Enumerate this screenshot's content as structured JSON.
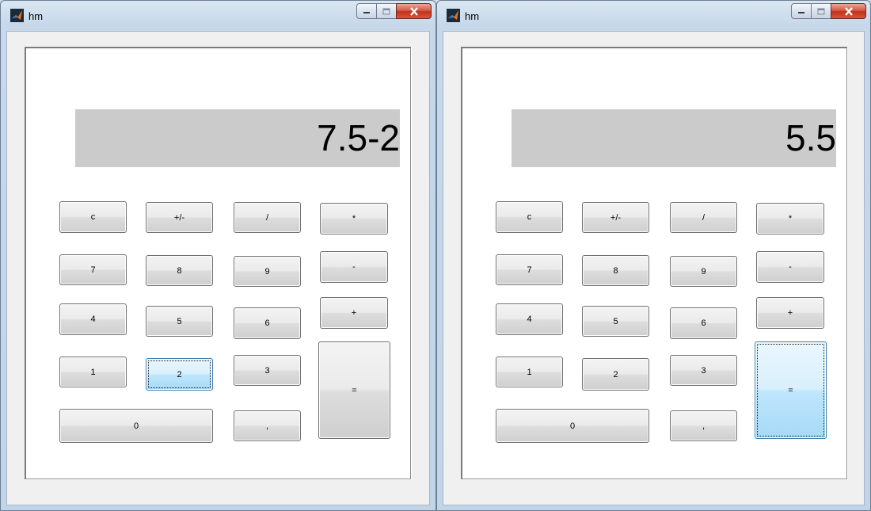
{
  "windows": [
    {
      "title": "hm",
      "display": "7.5-2",
      "buttons": {
        "c": "c",
        "plusminus": "+/-",
        "divide": "/",
        "multiply": "*",
        "seven": "7",
        "eight": "8",
        "nine": "9",
        "minus": "-",
        "four": "4",
        "five": "5",
        "six": "6",
        "plus": "+",
        "one": "1",
        "two": "2",
        "three": "3",
        "equals": "=",
        "zero": "0",
        "decimal": ","
      },
      "focused_button": "two"
    },
    {
      "title": "hm",
      "display": "5.5",
      "buttons": {
        "c": "c",
        "plusminus": "+/-",
        "divide": "/",
        "multiply": "*",
        "seven": "7",
        "eight": "8",
        "nine": "9",
        "minus": "-",
        "four": "4",
        "five": "5",
        "six": "6",
        "plus": "+",
        "one": "1",
        "two": "2",
        "three": "3",
        "equals": "=",
        "zero": "0",
        "decimal": ","
      },
      "focused_button": "equals"
    }
  ],
  "icons": {
    "app": "matlab-logo-icon",
    "minimize": "minimize-icon",
    "maximize": "maximize-icon",
    "close": "close-icon"
  },
  "colors": {
    "display_bg": "#cbcbcb",
    "focused_button": "#bee6fd",
    "close_button": "#c2311b"
  }
}
